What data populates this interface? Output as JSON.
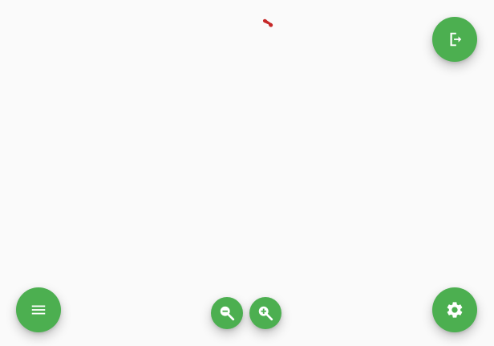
{
  "colors": {
    "fab": "#4caf50",
    "icon": "#ffffff",
    "marker": "#c62828",
    "background": "#fafafa"
  },
  "controls": {
    "exit": {
      "icon": "exit-to-app-icon"
    },
    "menu": {
      "icon": "menu-icon"
    },
    "settings": {
      "icon": "gear-icon"
    },
    "zoom_out": {
      "icon": "zoom-out-icon"
    },
    "zoom_in": {
      "icon": "zoom-in-icon"
    }
  },
  "canvas": {
    "marker": {
      "icon": "red-marker-icon"
    }
  }
}
